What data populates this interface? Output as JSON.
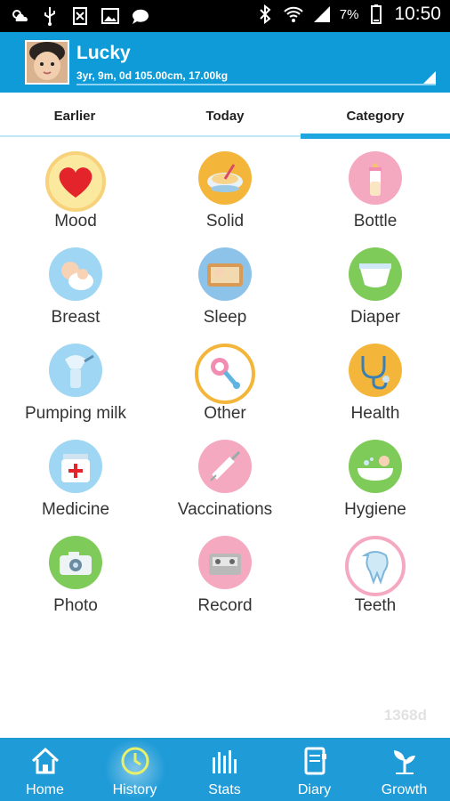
{
  "status_bar": {
    "battery": "7%",
    "time": "10:50"
  },
  "header": {
    "name": "Lucky",
    "info": "3yr, 9m, 0d 105.00cm, 17.00kg"
  },
  "tabs": [
    {
      "label": "Earlier"
    },
    {
      "label": "Today"
    },
    {
      "label": "Category"
    }
  ],
  "categories": [
    {
      "label": "Mood",
      "icon": "heart-icon",
      "color": "#fbe9a0"
    },
    {
      "label": "Solid",
      "icon": "bowl-icon",
      "color": "#f3b63b"
    },
    {
      "label": "Bottle",
      "icon": "bottle-icon",
      "color": "#f5a9c0"
    },
    {
      "label": "Breast",
      "icon": "breastfeeding-icon",
      "color": "#9fd6f3"
    },
    {
      "label": "Sleep",
      "icon": "crib-icon",
      "color": "#8ec3e9"
    },
    {
      "label": "Diaper",
      "icon": "diaper-icon",
      "color": "#7fcb5a"
    },
    {
      "label": "Pumping milk",
      "icon": "breast-pump-icon",
      "color": "#9fd6f3"
    },
    {
      "label": "Other",
      "icon": "rattle-icon",
      "color": "#f3b63b"
    },
    {
      "label": "Health",
      "icon": "stethoscope-icon",
      "color": "#f3b63b"
    },
    {
      "label": "Medicine",
      "icon": "medicine-bottle-icon",
      "color": "#9fd6f3"
    },
    {
      "label": "Vaccinations",
      "icon": "syringe-icon",
      "color": "#f5a9c0"
    },
    {
      "label": "Hygiene",
      "icon": "bathtub-icon",
      "color": "#7fcb5a"
    },
    {
      "label": "Photo",
      "icon": "camera-icon",
      "color": "#7fcb5a"
    },
    {
      "label": "Record",
      "icon": "cassette-icon",
      "color": "#f5a9c0"
    },
    {
      "label": "Teeth",
      "icon": "tooth-icon",
      "color": "#f5a9c0"
    }
  ],
  "watermark": "1368d",
  "bottom_nav": [
    {
      "label": "Home",
      "icon": "home-icon"
    },
    {
      "label": "History",
      "icon": "clock-icon"
    },
    {
      "label": "Stats",
      "icon": "stats-icon"
    },
    {
      "label": "Diary",
      "icon": "diary-icon"
    },
    {
      "label": "Growth",
      "icon": "sprout-icon"
    }
  ],
  "colors": {
    "header": "#0f9ad8",
    "bottom_nav": "#1f9bd7",
    "tab_active": "#1fa6e1"
  }
}
